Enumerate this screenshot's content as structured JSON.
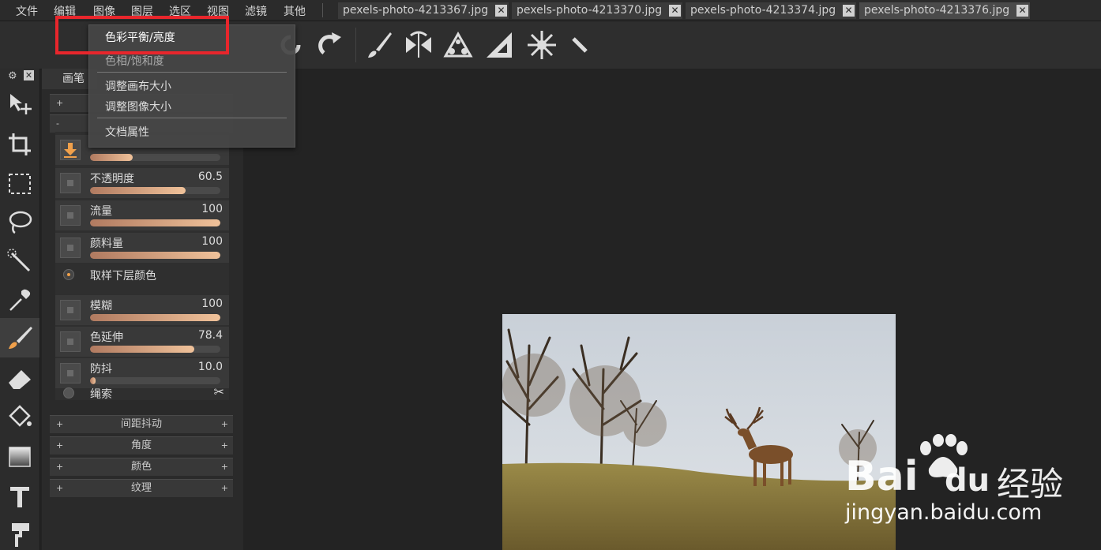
{
  "menubar": {
    "items": [
      "文件",
      "编辑",
      "图像",
      "图层",
      "选区",
      "视图",
      "滤镜",
      "其他"
    ],
    "tabs": [
      "pexels-photo-4213367.jpg",
      "pexels-photo-4213370.jpg",
      "pexels-photo-4213374.jpg",
      "pexels-photo-4213376.jpg"
    ]
  },
  "dropdown": {
    "items": [
      "色彩平衡/亮度",
      "色相/饱和度",
      "调整画布大小",
      "调整图像大小",
      "文档属性"
    ]
  },
  "panel": {
    "tab": "画笔",
    "brush_rows": [
      {
        "label": "不透明度",
        "value": "60.5",
        "fill": 0.735
      },
      {
        "label": "流量",
        "value": "100",
        "fill": 1.0
      },
      {
        "label": "颜料量",
        "value": "100",
        "fill": 1.0
      },
      {
        "label": "模糊",
        "value": "100",
        "fill": 1.0
      },
      {
        "label": "色延伸",
        "value": "78.4",
        "fill": 0.8
      },
      {
        "label": "防抖",
        "value": "10.0",
        "fill": 0.04
      }
    ],
    "size_fill": 0.33,
    "sample_label": "取样下层颜色",
    "lasso_label": "绳索",
    "sections": [
      "间距抖动",
      "角度",
      "颜色",
      "纹理"
    ]
  },
  "watermark": {
    "brand": "Bai",
    "brand2": "du",
    "cn": "经验",
    "url": "jingyan.baidu.com"
  }
}
